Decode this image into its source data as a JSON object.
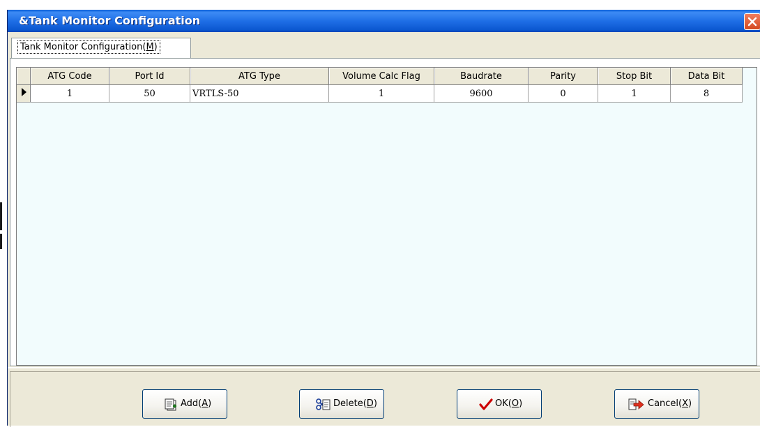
{
  "window": {
    "title": "&Tank Monitor Configuration",
    "close_icon": "close-icon"
  },
  "tabs": [
    {
      "label_prefix": "Tank Monitor Configuration(",
      "mnemonic": "M",
      "label_suffix": ")"
    }
  ],
  "grid": {
    "columns": [
      "ATG Code",
      "Port Id",
      "ATG Type",
      "Volume Calc Flag",
      "Baudrate",
      "Parity",
      "Stop Bit",
      "Data Bit"
    ],
    "rows": [
      [
        "1",
        "50",
        "VRTLS-50",
        "1",
        "9600",
        "0",
        "1",
        "8"
      ]
    ],
    "row_indicator_icon": "current-row-arrow-icon"
  },
  "buttons": {
    "add": {
      "label": "Add(",
      "mnemonic": "A",
      "suffix": ")",
      "icon": "add-record-icon"
    },
    "delete": {
      "label": "Delete(",
      "mnemonic": "D",
      "suffix": ")",
      "icon": "delete-record-icon"
    },
    "ok": {
      "label": "OK(",
      "mnemonic": "O",
      "suffix": ")",
      "icon": "checkmark-icon"
    },
    "cancel": {
      "label": "Cancel(",
      "mnemonic": "X",
      "suffix": ")",
      "icon": "cancel-exit-icon"
    }
  },
  "colors": {
    "titlebar": "#1f6fe6",
    "grid_background": "#f2fcfd",
    "dialog_face": "#ece9d8",
    "ok_check": "#cc0000"
  }
}
